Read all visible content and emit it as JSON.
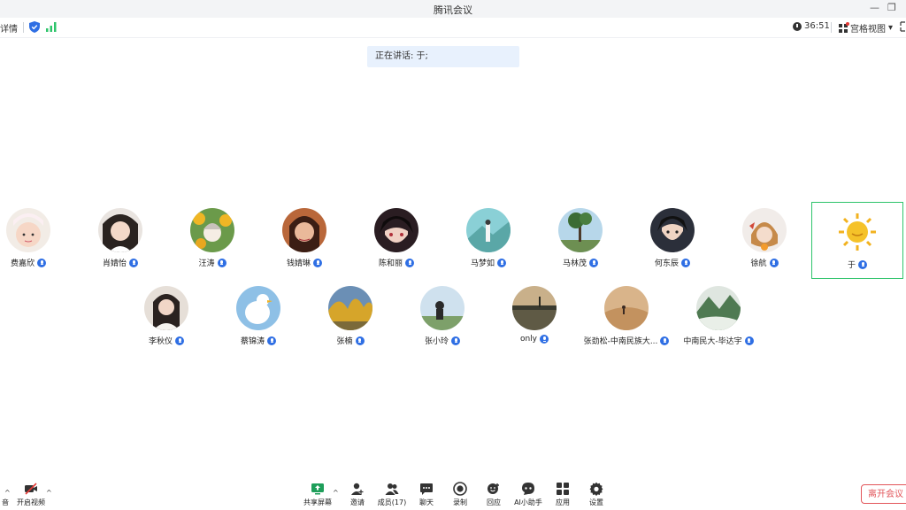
{
  "window": {
    "title": "腾讯会议",
    "minimize_glyph": "—",
    "restore_glyph": "❐"
  },
  "infobar": {
    "details_label": "详情",
    "timer": "36:51",
    "gallery_label": "宫格视图",
    "gallery_caret": "▾",
    "shield_color": "#2f6fe4",
    "signal_color": "#2ec46b"
  },
  "speaking": {
    "label": "正在讲话: 于;"
  },
  "participants": [
    {
      "name": "费嘉欣"
    },
    {
      "name": "肖婧怡"
    },
    {
      "name": "汪涛"
    },
    {
      "name": "钱婧琳"
    },
    {
      "name": "陈和丽"
    },
    {
      "name": "马梦如"
    },
    {
      "name": "马林茂"
    },
    {
      "name": "何东辰"
    },
    {
      "name": "徐航"
    },
    {
      "name": "于"
    },
    {
      "name": "李秋仪"
    },
    {
      "name": "蔡锦涛"
    },
    {
      "name": "张楠"
    },
    {
      "name": "张小玲"
    },
    {
      "name": "only"
    },
    {
      "name": "张劲松-中南民族大..."
    },
    {
      "name": "中南民大-毕达宇"
    }
  ],
  "toolbar": {
    "mute_label": "音",
    "video_label": "开启视频",
    "share_label": "共享屏幕",
    "invite_label": "邀请",
    "members_label": "成员(17)",
    "chat_label": "聊天",
    "record_label": "录制",
    "reply_label": "回应",
    "ai_label": "AI小助手",
    "apps_label": "应用",
    "settings_label": "设置",
    "leave_label": "离开会议",
    "caret": "^"
  },
  "colors": {
    "accent": "#2f6fe4",
    "active_border": "#2ec46b",
    "leave": "#e2555a"
  }
}
